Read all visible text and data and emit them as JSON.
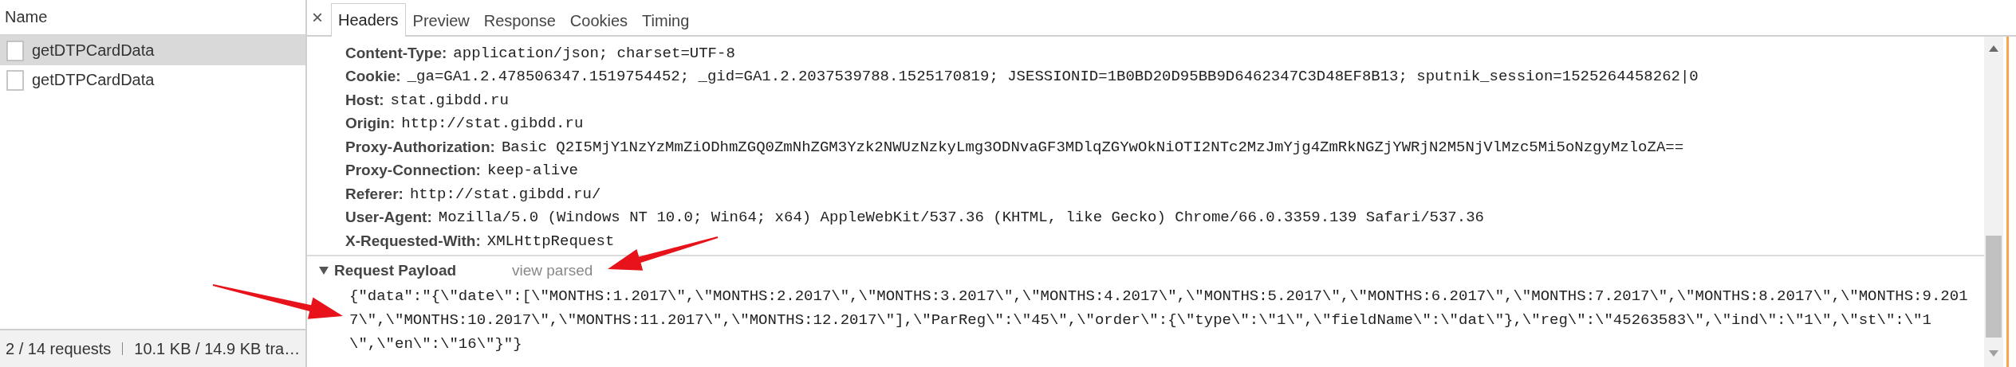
{
  "request_list": {
    "column_header": "Name",
    "rows": [
      {
        "name": "getDTPCardData",
        "selected": true
      },
      {
        "name": "getDTPCardData",
        "selected": false
      }
    ]
  },
  "status_bar": {
    "requests": "2 / 14 requests",
    "transferred": "10.1 KB / 14.9 KB tra…"
  },
  "detail": {
    "close_button": "×",
    "tabs": [
      {
        "label": "Headers",
        "selected": true
      },
      {
        "label": "Preview",
        "selected": false
      },
      {
        "label": "Response",
        "selected": false
      },
      {
        "label": "Cookies",
        "selected": false
      },
      {
        "label": "Timing",
        "selected": false
      }
    ],
    "headers": [
      {
        "name": "Content-Type:",
        "value": "application/json; charset=UTF-8"
      },
      {
        "name": "Cookie:",
        "value": "_ga=GA1.2.478506347.1519754452; _gid=GA1.2.2037539788.1525170819; JSESSIONID=1B0BD20D95BB9D6462347C3D48EF8B13; sputnik_session=1525264458262|0"
      },
      {
        "name": "Host:",
        "value": "stat.gibdd.ru"
      },
      {
        "name": "Origin:",
        "value": "http://stat.gibdd.ru"
      },
      {
        "name": "Proxy-Authorization:",
        "value": "Basic Q2I5MjY1NzYzMmZiODhmZGQ0ZmNhZGM3Yzk2NWUzNzkyLmg3ODNvaGF3MDlqZGYwOkNiOTI2NTc2MzJmYjg4ZmRkNGZjYWRjN2M5NjVlMzc5Mi5oNzgyMzloZA=="
      },
      {
        "name": "Proxy-Connection:",
        "value": "keep-alive"
      },
      {
        "name": "Referer:",
        "value": "http://stat.gibdd.ru/"
      },
      {
        "name": "User-Agent:",
        "value": "Mozilla/5.0 (Windows NT 10.0; Win64; x64) AppleWebKit/537.36 (KHTML, like Gecko) Chrome/66.0.3359.139 Safari/537.36"
      },
      {
        "name": "X-Requested-With:",
        "value": "XMLHttpRequest"
      }
    ],
    "payload": {
      "title": "Request Payload",
      "expanded": true,
      "view_link": "view parsed",
      "lines": [
        "{\"data\":\"{\\\"date\\\":[\\\"MONTHS:1.2017\\\",\\\"MONTHS:2.2017\\\",\\\"MONTHS:3.2017\\\",\\\"MONTHS:4.2017\\\",\\\"MONTHS:5.2017\\\",\\\"MONTHS:6.2017\\\",\\\"MONTHS:7.2017\\\",\\\"MONTHS:8.2017\\\",\\\"MONTHS:9.201",
        "7\\\",\\\"MONTHS:10.2017\\\",\\\"MONTHS:11.2017\\\",\\\"MONTHS:12.2017\\\"],\\\"ParReg\\\":\\\"45\\\",\\\"order\\\":{\\\"type\\\":\\\"1\\\",\\\"fieldName\\\":\\\"dat\\\"},\\\"reg\\\":\\\"45263583\\\",\\\"ind\\\":\\\"1\\\",\\\"st\\\":\\\"1",
        "\\\",\\\"en\\\":\\\"16\\\"}\"}"
      ]
    }
  }
}
